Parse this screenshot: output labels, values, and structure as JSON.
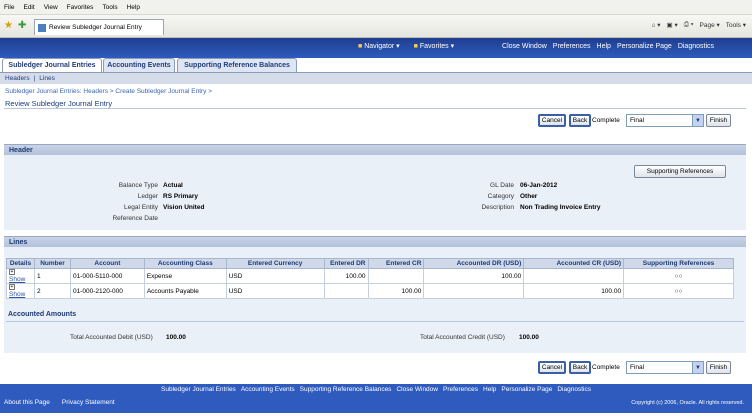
{
  "browser": {
    "menu": [
      "File",
      "Edit",
      "View",
      "Favorites",
      "Tools",
      "Help"
    ],
    "tab_title": "Review Subledger Journal Entry",
    "tools": [
      "Page ▾",
      "Tools ▾"
    ]
  },
  "app": {
    "nav_menus": [
      {
        "label": "Navigator ▾"
      },
      {
        "label": "Favorites ▾"
      }
    ],
    "global_links": [
      "Close Window",
      "Preferences",
      "Help",
      "Personalize Page",
      "Diagnostics"
    ],
    "tabs": [
      "Subledger Journal Entries",
      "Accounting Events",
      "Supporting Reference Balances"
    ],
    "subtabs": [
      "Headers",
      "Lines"
    ],
    "breadcrumb": "Subledger Journal Entries: Headers  >   Create Subledger Journal Entry  >",
    "page_title": "Review Subledger Journal Entry"
  },
  "actions": {
    "cancel": "Cancel",
    "back": "Back",
    "complete_label": "Complete",
    "complete_value": "Final",
    "finish": "Finish"
  },
  "header_section": {
    "title": "Header",
    "supporting_references": "Supporting References",
    "left": [
      {
        "label": "Balance Type",
        "value": "Actual"
      },
      {
        "label": "Ledger",
        "value": "RS Primary"
      },
      {
        "label": "Legal Entity",
        "value": "Vision United"
      },
      {
        "label": "Reference Date",
        "value": ""
      }
    ],
    "right": [
      {
        "label": "GL Date",
        "value": "06-Jan-2012"
      },
      {
        "label": "Category",
        "value": "Other"
      },
      {
        "label": "Description",
        "value": "Non Trading Invoice Entry"
      }
    ]
  },
  "lines_section": {
    "title": "Lines",
    "columns": [
      "Details",
      "Number",
      "Account",
      "Accounting Class",
      "Entered Currency",
      "Entered DR",
      "Entered CR",
      "Accounted DR (USD)",
      "Accounted CR (USD)",
      "Supporting References"
    ],
    "rows": [
      {
        "details": "Show",
        "number": "1",
        "account": "01-000-5110-000",
        "class": "Expense",
        "currency": "USD",
        "entered_dr": "100.00",
        "entered_cr": "",
        "acc_dr": "100.00",
        "acc_cr": "",
        "ref": "○○"
      },
      {
        "details": "Show",
        "number": "2",
        "account": "01-000-2120-000",
        "class": "Accounts Payable",
        "currency": "USD",
        "entered_dr": "",
        "entered_cr": "100.00",
        "acc_dr": "",
        "acc_cr": "100.00",
        "ref": "○○"
      }
    ]
  },
  "accounted": {
    "title": "Accounted Amounts",
    "debit_label": "Total Accounted Debit (USD)",
    "debit_value": "100.00",
    "credit_label": "Total Accounted Credit (USD)",
    "credit_value": "100.00"
  },
  "footer": {
    "links": [
      "Subledger Journal Entries",
      "Accounting Events",
      "Supporting Reference Balances",
      "Close Window",
      "Preferences",
      "Help",
      "Personalize Page",
      "Diagnostics"
    ],
    "about": "About this Page",
    "privacy": "Privacy Statement",
    "copyright": "Copyright (c) 2006, Oracle. All rights reserved."
  }
}
